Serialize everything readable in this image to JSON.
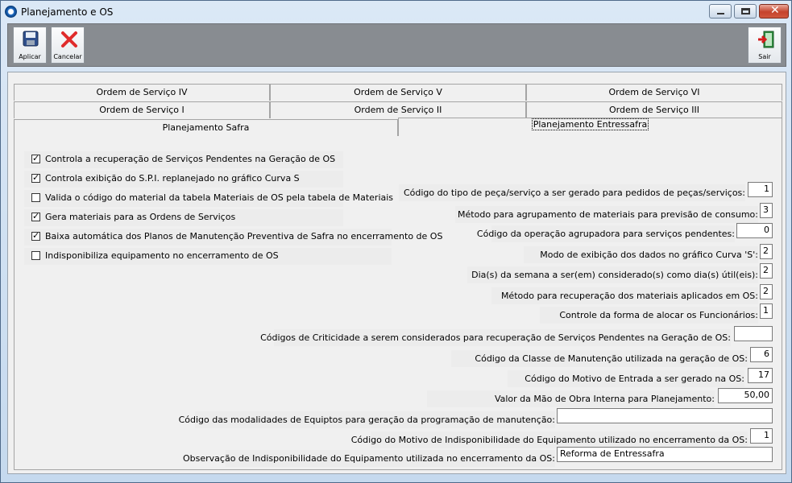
{
  "window": {
    "title": "Planejamento e OS"
  },
  "toolbar": {
    "aplicar_label": "Aplicar",
    "cancelar_label": "Cancelar",
    "sair_label": "Sair"
  },
  "tabs": {
    "row1": [
      "Ordem de Serviço IV",
      "Ordem de Serviço V",
      "Ordem de Serviço VI"
    ],
    "row2": [
      "Ordem de Serviço I",
      "Ordem de Serviço II",
      "Ordem de Serviço III"
    ],
    "row3": [
      "Planejamento Safra",
      "Planejamento Entressafra"
    ],
    "active": "Planejamento Entressafra"
  },
  "checkboxes": [
    {
      "label": "Controla a recuperação de Serviços Pendentes na Geração de OS",
      "checked": true
    },
    {
      "label": "Controla exibição do S.P.I. replanejado no gráfico Curva S",
      "checked": true
    },
    {
      "label": "Valida o código do material da tabela Materiais de OS pela tabela de Materiais",
      "checked": false
    },
    {
      "label": "Gera materiais para as Ordens de Serviços",
      "checked": true
    },
    {
      "label": "Baixa automática dos Planos de Manutenção Preventiva de Safra no encerramento de OS",
      "checked": true
    },
    {
      "label": "Indisponibiliza equipamento no encerramento de OS",
      "checked": false
    }
  ],
  "fields": [
    {
      "label": "Código do tipo de peça/serviço a ser gerado para pedidos de peças/serviços:",
      "value": "1"
    },
    {
      "label": "Método para agrupamento de materiais para previsão de consumo:",
      "value": "3"
    },
    {
      "label": "Código da operação agrupadora para serviços pendentes:",
      "value": "0"
    },
    {
      "label": "Modo de exibição dos dados no gráfico Curva 'S':",
      "value": "2"
    },
    {
      "label": "Dia(s) da semana a ser(em) considerado(s) como dia(s) útil(eis):",
      "value": "2"
    },
    {
      "label": "Método para recuperação dos materiais aplicados em OS:",
      "value": "2"
    },
    {
      "label": "Controle da forma de alocar os Funcionários:",
      "value": "1"
    },
    {
      "label": "Códigos de Criticidade a serem considerados para recuperação de Serviços Pendentes na Geração de OS:",
      "value": ""
    },
    {
      "label": "Código da Classe de Manutenção utilizada na geração de OS:",
      "value": "6"
    },
    {
      "label": "Código do Motivo de Entrada a ser gerado na OS:",
      "value": "17"
    },
    {
      "label": "Valor da Mão de Obra Interna para Planejamento:",
      "value": "50,00"
    },
    {
      "label": "Código das modalidades de Equiptos para geração da programação de manutenção:",
      "value": ""
    },
    {
      "label": "Código do Motivo de Indisponibilidade do Equipamento utilizado no encerramento da OS:",
      "value": "1"
    },
    {
      "label": "Observação de Indisponibilidade do Equipamento utilizada no encerramento da OS:",
      "value": "Reforma de Entressafra"
    }
  ]
}
